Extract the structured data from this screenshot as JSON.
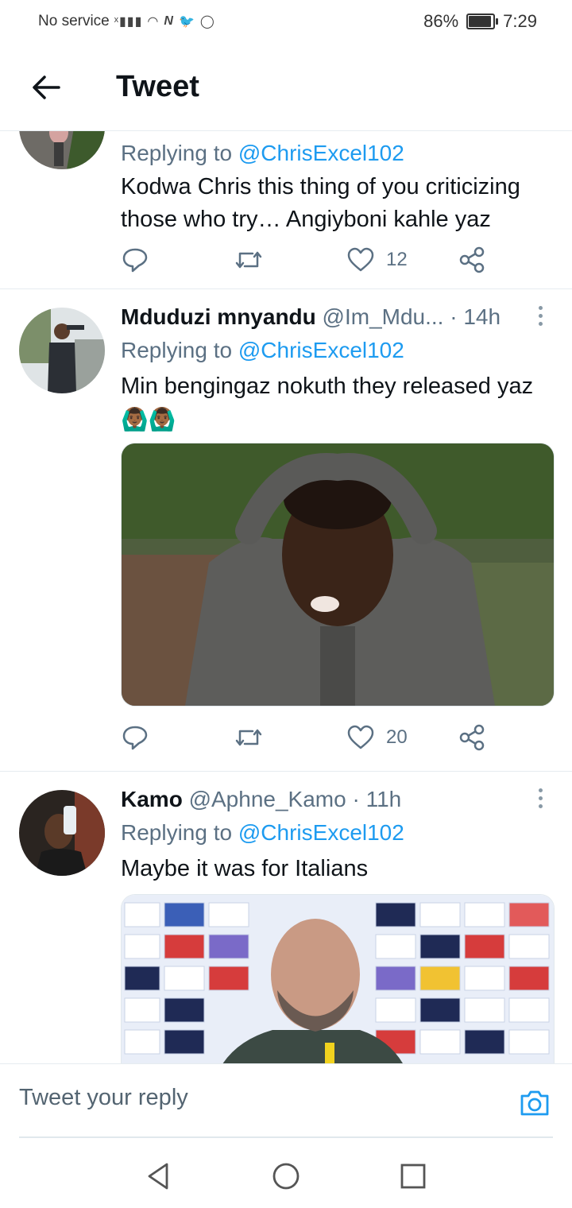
{
  "status_bar": {
    "carrier": "No service",
    "battery": "86%",
    "battery_level": 0.86,
    "time": "7:29"
  },
  "header": {
    "title": "Tweet",
    "back_icon": "arrow-left-icon"
  },
  "tweets": [
    {
      "replying_prefix": "Replying to",
      "replying_to": "@ChrisExcel102",
      "text": "Kodwa Chris this thing of you criticizing those who try… Angiyboni kahle yaz",
      "likes": "12"
    },
    {
      "name": "Mduduzi mnyandu",
      "handle": "@Im_Mdu...",
      "time": "· 14h",
      "replying_prefix": "Replying to",
      "replying_to": "@ChrisExcel102",
      "text": "Min bengingaz nokuth they released yaz",
      "emoji": "🙆🏾‍♂️🙆🏾‍♂️",
      "likes": "20"
    },
    {
      "name": "Kamo",
      "handle": "@Aphne_Kamo",
      "time": "· 11h",
      "replying_prefix": "Replying to",
      "replying_to": "@ChrisExcel102",
      "text": "Maybe it was for Italians"
    }
  ],
  "compose": {
    "placeholder": "Tweet your reply"
  },
  "colors": {
    "accent": "#1d9bf0",
    "muted": "#5b7083",
    "text": "#0f1419"
  }
}
